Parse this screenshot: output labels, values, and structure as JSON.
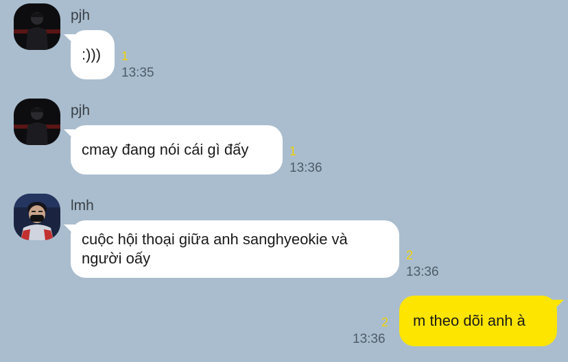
{
  "messages": [
    {
      "sender": "pjh",
      "text": ":)))",
      "unread": "1",
      "time": "13:35",
      "avatar": "pjh-avatar"
    },
    {
      "sender": "pjh",
      "text": "cmay đang nói cái gì đấy",
      "unread": "1",
      "time": "13:36",
      "avatar": "pjh-avatar"
    },
    {
      "sender": "lmh",
      "text_line1": "cuộc hội thoại giữa anh sanghyeokie và",
      "text_line2": "người oấy",
      "unread": "2",
      "time": "13:36",
      "avatar": "lmh-avatar"
    },
    {
      "sender": "me",
      "text": "m theo dõi anh à",
      "unread": "2",
      "time": "13:36"
    }
  ],
  "colors": {
    "background": "#a9bdce",
    "incoming_bubble": "#ffffff",
    "outgoing_bubble": "#fee500",
    "unread_count": "#f2d200",
    "timestamp": "#4e5b68"
  }
}
